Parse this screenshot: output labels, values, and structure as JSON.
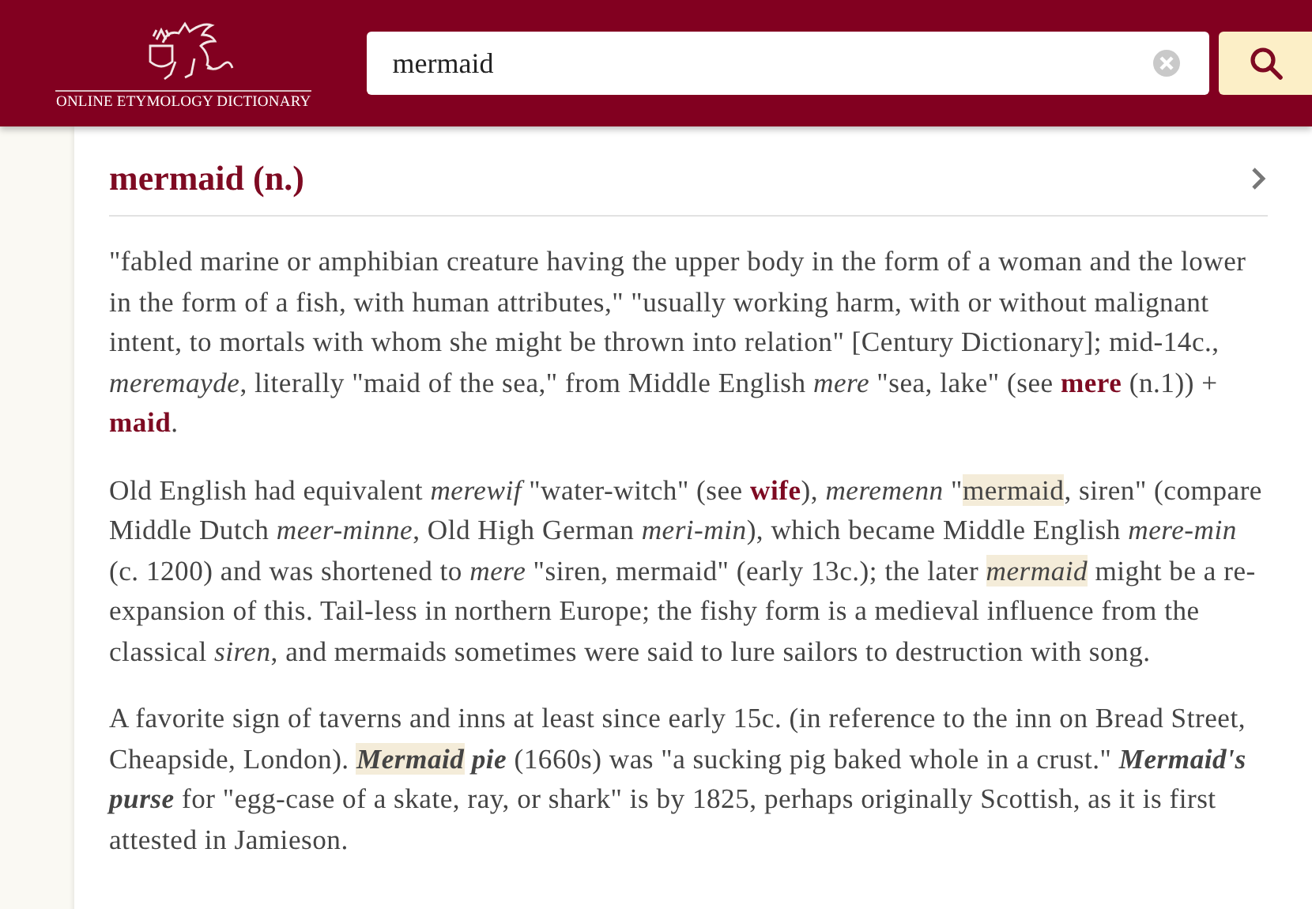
{
  "header": {
    "logo_text": "ONLINE ETYMOLOGY DICTIONARY",
    "search": {
      "value": "mermaid"
    }
  },
  "entry": {
    "title": "mermaid (n.)",
    "paragraphs": [
      [
        {
          "kind": "text",
          "text": "\"fabled marine or amphibian creature having the upper body in the form of a woman and the lower in the form of a fish, with human attributes,\" \"usually working harm, with or without malignant intent, to mortals with whom she might be thrown into relation\" [Century Dictionary]; mid-14c., "
        },
        {
          "kind": "italic",
          "text": "meremayde"
        },
        {
          "kind": "text",
          "text": ", literally \"maid of the sea,\" from Middle English "
        },
        {
          "kind": "italic",
          "text": "mere"
        },
        {
          "kind": "text",
          "text": " \"sea, lake\" (see "
        },
        {
          "kind": "link",
          "text": "mere"
        },
        {
          "kind": "text",
          "text": " (n.1)) + "
        },
        {
          "kind": "link",
          "text": "maid"
        },
        {
          "kind": "text",
          "text": "."
        }
      ],
      [
        {
          "kind": "text",
          "text": "Old English had equivalent "
        },
        {
          "kind": "italic",
          "text": "merewif"
        },
        {
          "kind": "text",
          "text": " \"water-witch\" (see "
        },
        {
          "kind": "link",
          "text": "wife"
        },
        {
          "kind": "text",
          "text": "), "
        },
        {
          "kind": "italic",
          "text": "meremenn"
        },
        {
          "kind": "text",
          "text": " \""
        },
        {
          "kind": "mark",
          "text": "mermaid"
        },
        {
          "kind": "text",
          "text": ", siren\" (compare Middle Dutch "
        },
        {
          "kind": "italic",
          "text": "meer-minne"
        },
        {
          "kind": "text",
          "text": ", Old High German "
        },
        {
          "kind": "italic",
          "text": "meri-min"
        },
        {
          "kind": "text",
          "text": "), which became Middle English "
        },
        {
          "kind": "italic",
          "text": "mere-min"
        },
        {
          "kind": "text",
          "text": " (c. 1200) and was shortened to "
        },
        {
          "kind": "italic",
          "text": "mere"
        },
        {
          "kind": "text",
          "text": " \"siren, mermaid\" (early 13c.); the later "
        },
        {
          "kind": "mark_italic",
          "text": "mermaid"
        },
        {
          "kind": "text",
          "text": " might be a re-expansion of this. Tail-less in northern Europe; the fishy form is a medieval influence from the classical "
        },
        {
          "kind": "italic",
          "text": "siren"
        },
        {
          "kind": "text",
          "text": ", and mermaids sometimes were said to lure sailors to destruction with song."
        }
      ],
      [
        {
          "kind": "text",
          "text": "A favorite sign of taverns and inns at least since early 15c. (in reference to the inn on Bread Street, Cheapside, London). "
        },
        {
          "kind": "mark_bold_italic",
          "text": "Mermaid"
        },
        {
          "kind": "bold_italic",
          "text": " pie"
        },
        {
          "kind": "text",
          "text": " (1660s) was \"a sucking pig baked whole in a crust.\" "
        },
        {
          "kind": "bold_italic",
          "text": "Mermaid's purse"
        },
        {
          "kind": "text",
          "text": " for \"egg-case of a skate, ray, or shark\" is by 1825, perhaps originally Scottish, as it is first attested in Jamieson."
        }
      ]
    ]
  }
}
